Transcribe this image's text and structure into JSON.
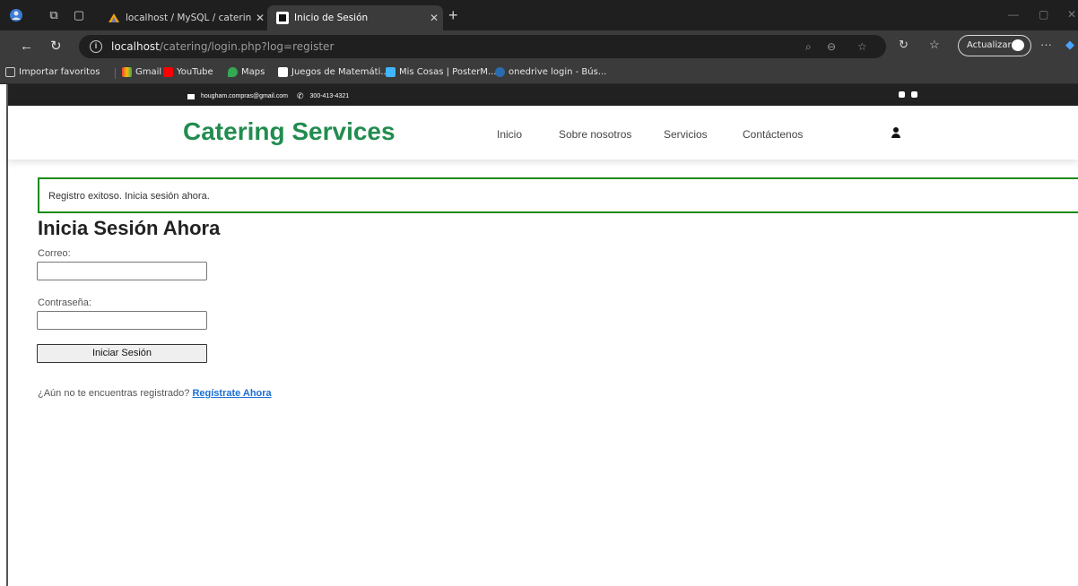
{
  "browser": {
    "tabs": [
      {
        "label": "localhost / MySQL / cateringdb / ..."
      },
      {
        "label": "Inicio de Sesión"
      }
    ],
    "url_host": "localhost",
    "url_path": "/catering/login.php?log=register",
    "update_label": "Actualizar",
    "favorites": [
      {
        "label": "Importar favoritos"
      },
      {
        "label": "Gmail"
      },
      {
        "label": "YouTube"
      },
      {
        "label": "Maps"
      },
      {
        "label": "Juegos de Matemáti..."
      },
      {
        "label": "Mis Cosas | PosterM..."
      },
      {
        "label": "onedrive login - Bús..."
      }
    ]
  },
  "site": {
    "topbar": {
      "email": "hougham.compras@gmail.com",
      "phone": "300-413-4321"
    },
    "brand": "Catering Services",
    "nav": [
      {
        "label": "Inicio"
      },
      {
        "label": "Sobre nosotros"
      },
      {
        "label": "Servicios"
      },
      {
        "label": "Contáctenos"
      }
    ]
  },
  "alert": {
    "message": "Registro exitoso. Inicia sesión ahora."
  },
  "login": {
    "title": "Inicia Sesión Ahora",
    "email_label": "Correo:",
    "email_value": "",
    "password_label": "Contraseña:",
    "password_value": "",
    "submit_label": "Iniciar Sesión",
    "register_prompt": "¿Aún no te encuentras registrado?",
    "register_link": "Regístrate Ahora"
  },
  "colors": {
    "brand": "#218c4f",
    "alert_border": "#1a8a1a",
    "link": "#1a6fd6"
  },
  "icons": [
    "browser-profile-icon",
    "workspaces-icon",
    "tab-actions-icon",
    "info-icon",
    "mail-icon",
    "phone-icon",
    "user-icon"
  ]
}
